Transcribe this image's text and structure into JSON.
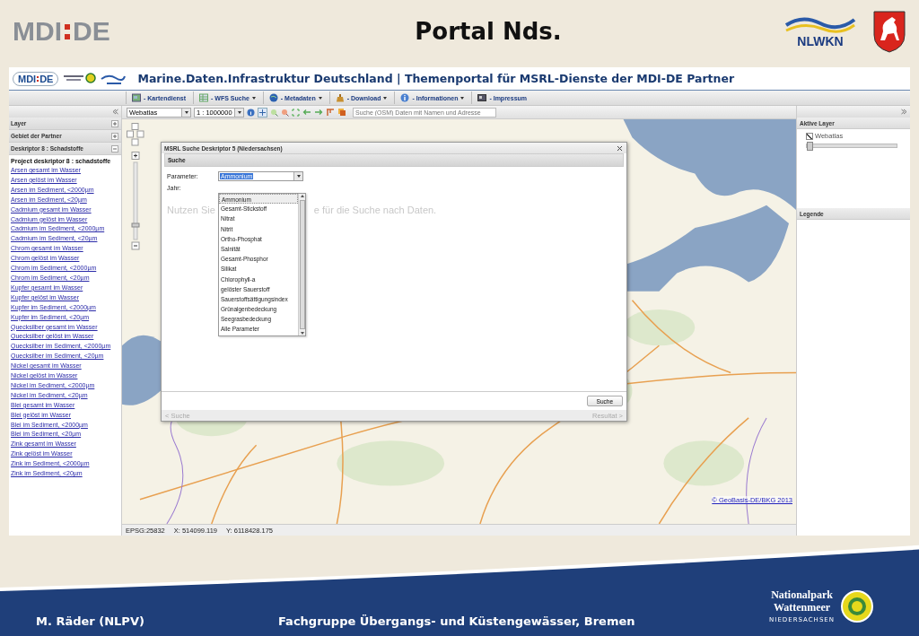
{
  "slide": {
    "title": "Portal Nds.",
    "logo_left": {
      "part_1": "MDI",
      "part_2": "DE"
    },
    "logo_right": "NLWKN"
  },
  "portal": {
    "title": "Marine.Daten.Infrastruktur Deutschland | Themenportal für MSRL-Dienste der MDI-DE Partner",
    "logo": {
      "part_1": "MDI",
      "part_2": "DE"
    }
  },
  "menu": [
    {
      "label": "- Kartendienst",
      "has_menu": false
    },
    {
      "label": "- WFS Suche",
      "has_menu": true
    },
    {
      "label": "- Metadaten",
      "has_menu": true
    },
    {
      "label": "- Download",
      "has_menu": true
    },
    {
      "label": "- Informationen",
      "has_menu": true
    },
    {
      "label": "- Impressum",
      "has_menu": false
    }
  ],
  "sidebar": {
    "sections": [
      {
        "label": "Layer",
        "expanded": false
      },
      {
        "label": "Gebiet der Partner",
        "expanded": false
      },
      {
        "label": "Deskriptor 8 : Schadstoffe",
        "expanded": true
      }
    ],
    "heading": "Project deskriptor 8 : schadstoffe",
    "links": [
      "Arsen gesamt im Wasser",
      "Arsen gelöst im Wasser",
      "Arsen im Sediment, <2000µm",
      "Arsen im Sediment, <20µm",
      "Cadmium gesamt im Wasser",
      "Cadmium gelöst im Wasser",
      "Cadmium im Sediment, <2000µm",
      "Cadmium im Sediment, <20µm",
      "Chrom gesamt im Wasser",
      "Chrom gelöst im Wasser",
      "Chrom im Sediment, <2000µm",
      "Chrom im Sediment, <20µm",
      "Kupfer gesamt im Wasser",
      "Kupfer gelöst im Wasser",
      "Kupfer im Sediment, <2000µm",
      "Kupfer im Sediment, <20µm",
      "Quecksilber gesamt im Wasser",
      "Quecksilber gelöst im Wasser",
      "Quecksilber im Sediment, <2000µm",
      "Quecksilber im Sediment, <20µm",
      "Nickel gesamt im Wasser",
      "Nickel gelöst im Wasser",
      "Nickel im Sediment, <2000µm",
      "Nickel im Sediment, <20µm",
      "Blei gesamt im Wasser",
      "Blei gelöst im Wasser",
      "Blei im Sediment, <2000µm",
      "Blei im Sediment, <20µm",
      "Zink gesamt im Wasser",
      "Zink gelöst im Wasser",
      "Zink im Sediment, <2000µm",
      "Zink im Sediment, <20µm"
    ]
  },
  "toolbar": {
    "base_layer": "Webatlas",
    "scale": "1 : 1000000",
    "search": {
      "placeholder": "Suche (OSM) Daten mit Namen und Adresse"
    }
  },
  "dialog": {
    "title": "MSRL Suche Deskriptor 5 (Niedersachsen)",
    "panel_title": "Suche",
    "parameter_label": "Parameter:",
    "parameter_value": "Ammonium",
    "year_label": "Jahr:",
    "hint_parts": [
      "Nutzen Sie",
      "e für die Suche nach Daten."
    ],
    "options": [
      {
        "label": "Ammonium",
        "selected": true
      },
      {
        "label": "Gesamt-Stickstoff",
        "selected": false
      },
      {
        "label": "Nitrat",
        "selected": false
      },
      {
        "label": "Nitrit",
        "selected": false
      },
      {
        "label": "Ortho-Phosphat",
        "selected": false
      },
      {
        "label": "Salnität",
        "selected": false
      },
      {
        "label": "Gesamt-Phosphor",
        "selected": false
      },
      {
        "label": "Silikat",
        "selected": false
      },
      {
        "label": "Chlorophyll-a",
        "selected": false
      },
      {
        "label": "gelöster Sauerstoff",
        "selected": false
      },
      {
        "label": "Sauerstoffsättigungsindex",
        "selected": false
      },
      {
        "label": "Grünalgenbedeckung",
        "selected": false
      },
      {
        "label": "Seegrasbedeckung",
        "selected": false
      },
      {
        "label": "Alle Parameter",
        "selected": false
      }
    ],
    "search_button": "Suche",
    "back": {
      "label": "< Suche",
      "disabled": true
    },
    "next": {
      "label": "Resultat >",
      "disabled": true
    }
  },
  "map": {
    "copyright": "© GeoBasis-DE/BKG 2013"
  },
  "status_bar": [
    "EPSG:25832",
    "X: 514099.119",
    "Y: 6118428.175"
  ],
  "right_panel": {
    "active_title": "Aktive Layer",
    "layers": [
      {
        "label": "Webatlas",
        "checked": true,
        "level": 0.0
      }
    ],
    "legend_title": "Legende"
  },
  "footer": {
    "author": "M. Räder (NLPV)",
    "event": "Fachgruppe Übergangs- und Küstengewässer, Bremen",
    "park_logo": {
      "line_1": "Nationalpark",
      "line_2": "Wattenmeer",
      "line_3": "NIEDERSACHSEN"
    }
  }
}
